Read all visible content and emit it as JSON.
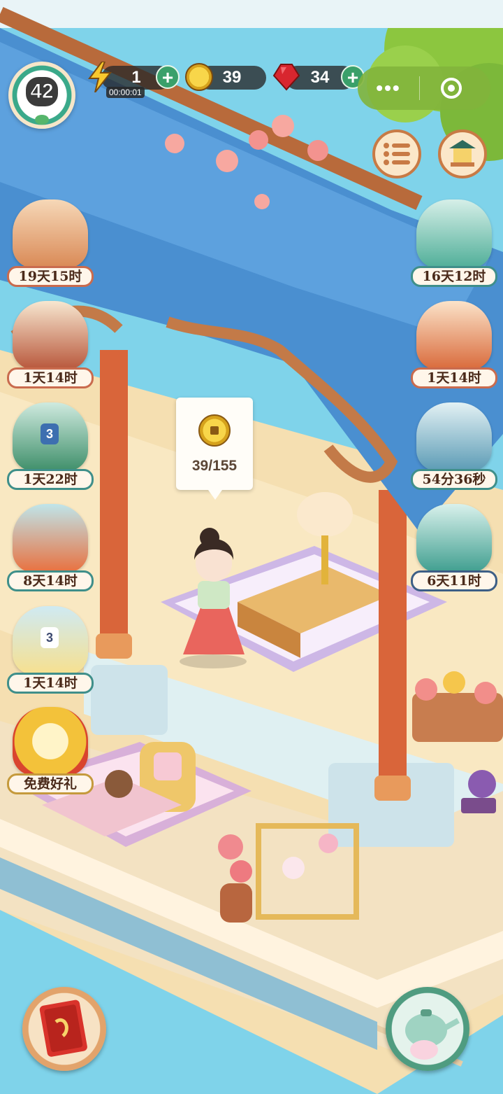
{
  "hud": {
    "level": "42",
    "energy": {
      "value": "1",
      "timer": "00:00:01"
    },
    "coins": {
      "value": "39"
    },
    "gems": {
      "value": "34"
    },
    "plus_symbol": "+",
    "capsule_more": "•••"
  },
  "events_left": [
    {
      "label": "19天15时"
    },
    {
      "label": "1天14时"
    },
    {
      "label": "1天22时",
      "badge": "3"
    },
    {
      "label": "8天14时"
    },
    {
      "label": "1天14时",
      "badge": "3"
    },
    {
      "label": "免费好礼"
    }
  ],
  "events_right": [
    {
      "label": "16天12时"
    },
    {
      "label": "1天14时"
    },
    {
      "label": "54分36秒"
    },
    {
      "label": "6天11时"
    }
  ],
  "tooltip": {
    "text": "39/155"
  },
  "colors": {
    "water": "#7fd3ea",
    "roof": "#4a8fd0",
    "floor": "#f5dfb1",
    "pillar": "#d9653a",
    "accent_green": "#3aa06a"
  }
}
